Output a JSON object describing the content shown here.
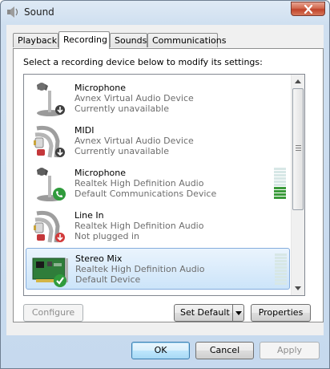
{
  "window": {
    "title": "Sound"
  },
  "tabs": [
    {
      "label": "Playback",
      "active": false
    },
    {
      "label": "Recording",
      "active": true
    },
    {
      "label": "Sounds",
      "active": false
    },
    {
      "label": "Communications",
      "active": false
    }
  ],
  "instruction": "Select a recording device below to modify its settings:",
  "devices": [
    {
      "name": "Microphone",
      "description": "Avnex Virtual Audio Device",
      "status": "Currently unavailable",
      "icon": "microphone-icon",
      "badge": "down-arrow-badge",
      "selected": false,
      "level_segments_lit": null
    },
    {
      "name": "MIDI",
      "description": "Avnex Virtual Audio Device",
      "status": "Currently unavailable",
      "icon": "rca-cable-icon",
      "badge": "down-arrow-badge",
      "selected": false,
      "level_segments_lit": null
    },
    {
      "name": "Microphone",
      "description": "Realtek High Definition Audio",
      "status": "Default Communications Device",
      "icon": "microphone-icon",
      "badge": "phone-badge",
      "selected": false,
      "level_segments_lit": 4
    },
    {
      "name": "Line In",
      "description": "Realtek High Definition Audio",
      "status": "Not plugged in",
      "icon": "rca-cable-icon",
      "badge": "red-down-arrow-badge",
      "selected": false,
      "level_segments_lit": null
    },
    {
      "name": "Stereo Mix",
      "description": "Realtek High Definition Audio",
      "status": "Default Device",
      "icon": "sound-card-icon",
      "badge": "green-check-badge",
      "selected": true,
      "level_segments_lit": 0
    }
  ],
  "buttons": {
    "configure": "Configure",
    "set_default": "Set Default",
    "properties": "Properties",
    "ok": "OK",
    "cancel": "Cancel",
    "apply": "Apply"
  },
  "colors": {
    "selection": "#cce4f9",
    "meter_on": "#3b9b3b",
    "meter_off": "#d7e7e6",
    "close_button": "#c0432a"
  }
}
